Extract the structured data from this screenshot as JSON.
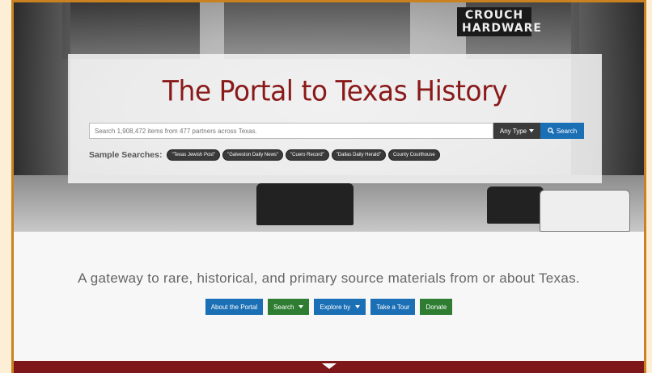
{
  "hero": {
    "sign_text": "CROUCH HARDWARE",
    "title": "The Portal to Texas History",
    "search": {
      "placeholder": "Search 1,908,472 items from 477 partners across Texas.",
      "type_label": "Any Type",
      "button_label": "Search"
    },
    "samples": {
      "label": "Sample Searches:",
      "items": [
        "\"Texas Jewish Post\"",
        "\"Galveston Daily News\"",
        "\"Cuero Record\"",
        "\"Dallas Daily Herald\"",
        "County Courthouse"
      ]
    }
  },
  "main": {
    "tagline": "A gateway to rare, historical, and primary source materials from or about Texas.",
    "buttons": {
      "about": "About the Portal",
      "search": "Search",
      "explore": "Explore by",
      "tour": "Take a Tour",
      "donate": "Donate"
    }
  },
  "colors": {
    "title": "#8a1a1a",
    "primary": "#1b6fb5",
    "success": "#2e7d32",
    "footer": "#7d1719",
    "frame": "#c9821f"
  },
  "icons": {
    "search": "search-icon",
    "dropdown": "chevron-down-icon"
  }
}
